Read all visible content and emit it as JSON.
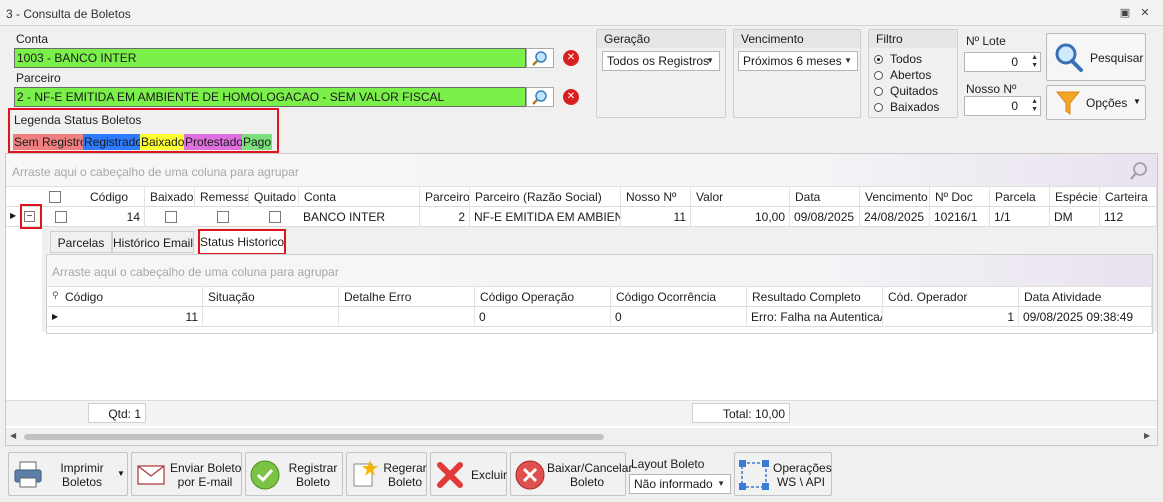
{
  "window": {
    "title": "3 - Consulta de Boletos",
    "controls": [
      "restore",
      "close"
    ]
  },
  "conta": {
    "label": "Conta",
    "value": "1003 - BANCO INTER"
  },
  "parceiro": {
    "label": "Parceiro",
    "value": "2 - NF-E EMITIDA EM AMBIENTE DE HOMOLOGACAO - SEM VALOR FISCAL"
  },
  "legend": {
    "title": "Legenda Status Boletos",
    "items": [
      {
        "label": "Sem Registro",
        "color": "#f08080"
      },
      {
        "label": "Registrado",
        "color": "#2f7bff"
      },
      {
        "label": "Baixado",
        "color": "#ffff33"
      },
      {
        "label": "Protestado",
        "color": "#e070e0"
      },
      {
        "label": "Pago",
        "color": "#7be07b"
      }
    ]
  },
  "geracao": {
    "label": "Geração",
    "value": "Todos os Registros"
  },
  "vencimento": {
    "label": "Vencimento",
    "value": "Próximos 6 meses"
  },
  "filtro": {
    "label": "Filtro",
    "options": [
      "Todos",
      "Abertos",
      "Quitados",
      "Baixados"
    ],
    "selected": "Todos"
  },
  "lote": {
    "label": "Nº Lote",
    "value": "0"
  },
  "nosso_numero": {
    "label": "Nosso Nº",
    "value": "0"
  },
  "buttons": {
    "pesquisar": "Pesquisar",
    "opcoes": "Opções"
  },
  "grid": {
    "group_hint": "Arraste aqui o cabeçalho de uma coluna para agrupar",
    "columns": [
      "Código",
      "Baixado",
      "Remessa",
      "Quitado",
      "Conta",
      "Parceiro",
      "Parceiro (Razão Social)",
      "Nosso Nº",
      "Valor",
      "Data",
      "Vencimento",
      "Nº Doc",
      "Parcela",
      "Espécie",
      "Carteira"
    ],
    "row": {
      "codigo": "14",
      "conta": "BANCO INTER",
      "parceiro": "2",
      "razao": "NF-E EMITIDA EM AMBIEN...",
      "nosso": "11",
      "valor": "10,00",
      "data": "09/08/2025",
      "vencimento": "24/08/2025",
      "doc": "10216/1",
      "parcela": "1/1",
      "especie": "DM",
      "carteira": "112"
    },
    "detail_tabs": [
      "Parcelas",
      "Histórico Email",
      "Status Historico"
    ],
    "detail_group_hint": "Arraste aqui o cabeçalho de uma coluna para agrupar",
    "detail_columns": [
      "Código",
      "Situação",
      "Detalhe Erro",
      "Código Operação",
      "Código Ocorrência",
      "Resultado Completo",
      "Cód. Operador",
      "Data Atividade"
    ],
    "detail_row": {
      "codigo": "11",
      "situacao": "",
      "detalhe": "",
      "cod_operacao": "0",
      "cod_ocorrencia": "0",
      "resultado": "Erro: Falha na AutenticaÃ...",
      "operador": "1",
      "data": "09/08/2025 09:38:49"
    },
    "footer": {
      "qtd": "Qtd: 1",
      "total": "Total: 10,00"
    }
  },
  "toolbar": {
    "imprimir": [
      "Imprimir",
      "Boletos"
    ],
    "enviar": [
      "Enviar Boleto",
      "por E-mail"
    ],
    "registrar": [
      "Registrar",
      "Boleto"
    ],
    "regerar": [
      "Regerar",
      "Boleto"
    ],
    "excluir": "Excluir",
    "baixar": [
      "Baixar/Cancelar",
      "Boleto"
    ],
    "layout_label": "Layout Boleto",
    "layout_value": "Não informado",
    "operacoes": [
      "Operações",
      "WS \\ API"
    ]
  }
}
